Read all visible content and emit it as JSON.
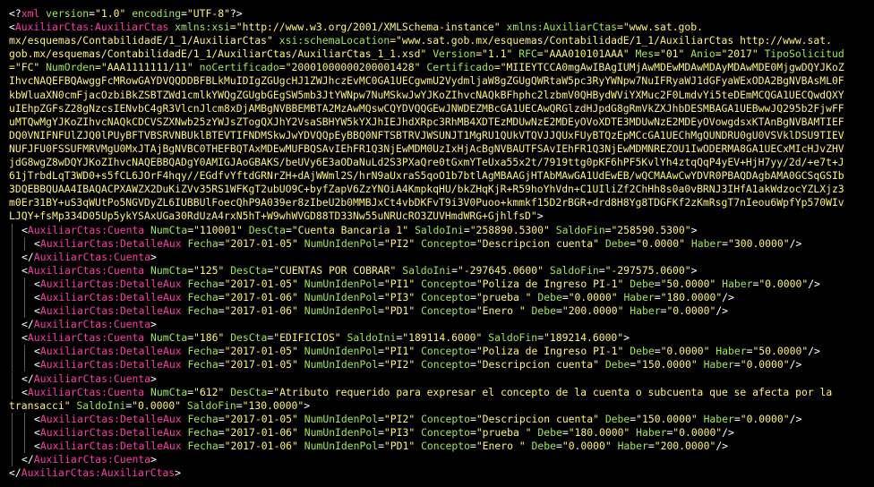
{
  "xml_declaration": {
    "text_open": "<?",
    "name": "xml",
    "version_attr": "version",
    "version_value": "\"1.0\"",
    "encoding_attr": "encoding",
    "encoding_value": "\"UTF-8\"",
    "text_close": "?>"
  },
  "root": {
    "tag": "AuxiliarCtas:AuxiliarCtas",
    "lines": [
      [
        "xmlns:xsi",
        "=\"http://www.w3.org/2001/XMLSchema-instance\"",
        "xmlns:AuxiliarCtas",
        "=\"www.sat.gob."
      ],
      [
        "",
        "mx/esquemas/ContabilidadE/1_1/AuxiliarCtas\"",
        "xsi:schemaLocation",
        "=\"www.sat.gob.mx/esquemas/ContabilidadE/1_1/AuxiliarCtas http://www.sat."
      ],
      [
        "",
        "gob.mx/esquemas/ContabilidadE/1_1/AuxiliarCtas/AuxiliarCtas_1_1.xsd\"",
        "Version",
        "=\"1.1\"",
        "RFC",
        "=\"AAA010101AAA\"",
        "Mes",
        "=\"01\"",
        "Anio",
        "=\"2017\"",
        "TipoSolicitud"
      ],
      [
        "",
        "=\"FC\"",
        "NumOrden",
        "=\"AAA1111111/11\"",
        "noCertificado",
        "=\"20001000000200001428\"",
        "Certificado",
        "=\"MIIEYTCCA0mgAwIBAgIUMjAwMDEwMDAwMDAyMDAwMDE0MjgwDQYJKoZ"
      ],
      [
        "",
        "IhvcNAQEFBQAwggFcMRowGAYDVQQDDBFBLkMuIDIgZGUgcHJ1ZWJhczEvMC0GA1UECgwmU2VydmljaW8gZGUgQWRtaW5pc3RyYWNpw7NuIFRyaWJ1dGFyaWExODA2BgNVBAsML0F"
      ],
      [
        "",
        "kbWluaXN0cmFjacOzbiBkZSBTZWd1cmlkYWQgZGUgbGEgSW5mb3JtYWNpw7NuMSkwJwYJKoZIhvcNAQkBFhphc2lzbmV0QHBydWViYXMuc2F0LmdvYi5teDEmMCQGA1UECQwdQXY"
      ],
      [
        "",
        "uIEhpZGFsZ28gNzcsIENvbC4gR3VlcnJlcm8xDjAMBgNVBBEMBTA2MzAwMQswCQYDVQQGEwJNWDEZMBcGA1UECAwQRGlzdHJpdG8gRmVkZXJhbDESMBAGA1UEBwwJQ295b2FjwFF"
      ],
      [
        "",
        "uMTQwMgYJKoZIhvcNAQkCDCVSZXNwb25zYWJsZTogQXJhY2VsaSBHYW5kYXJhIEJhdXRpc3RhMB4XDTEzMDUwNzE2MDEyOVoXDTE3MDUwNzE2MDEyOVowgdsxKTAnBgNVBAMTIEF"
      ],
      [
        "",
        "DQ0VNIFNFUlZJQ0lPUyBFTVBSRVNBUklBTEVTIFNDMSkwJwYDVQQpEyBBQ0NFTSBTRVJWSUNJT1MgRU1QUkVTQVJJQUxFUyBTQzEpMCcGA1UEChMgQUNDRU0gU0VSVklDSU9TIEV"
      ],
      [
        "",
        "NUFJFU0FSSUFMRVMgU0MxJTAjBgNVBC0THEFBQTAxMDEwMUFBQSAvIEhFR1Q3NjEwMDM0UzIxHjAcBgNVBAUTFSAvIEhFR1Q3NjEwMDMNREZOU1IwODERMA8GA1UECxMIcHJvZHV"
      ],
      [
        "",
        "jdG8wgZ8wDQYJKoZIhvcNAQEBBQADgY0AMIGJAoGBAKS/beUVy6E3aODaNuLd2S3PXaQre0tGxmYTeUxa55x2t/7919ttg0pKF6hPF5KvlYh4ztqQqP4yEV+HjH7yy/2d/+e7t+J"
      ],
      [
        "",
        "61jTrbdLqT3WD0+s5fCL6JOrF4hqy//EGdfvYftdGRNrZH+dAjWWml2S/hrN9aUxraS5qoO1b7btlAgMBAAGjHTAbMAwGA1UdEwEB/wQCMAAwCwYDVR0PBAQDAgbAMA0GCSqGSIb"
      ],
      [
        "",
        "3DQEBBQUAA4IBAQACPXAWZX2DuKiZVv35RS1WFKgT2ubUO9C+byfZapV6ZzYNOiA4KmpkqHU/bkZHqKjR+R59hoYhVdn+C1UIliZf2ChHh8s0a0vBRNJ3IHfA1akWdzocYZLXjz3"
      ],
      [
        "",
        "m0Er31BY+uS3qWUtPo5NGVDyZL6IUBBUlFoecQhP9A039er8zIbeU2b0MMBJxCt4vbDKFvT9i3V0Puoo+kmmkf15D2rBGR+drd8H8Yg8TDGFKf2zKmRsgT7nIeou6WpfYp570WIv"
      ],
      [
        "",
        "LJQY+fsMp334D05Up5ykYSAxUGa30RdUzA4rxN5hT+W9whWVGD88TD33Nw55uNRUcRO3ZUVHmdWRG+GjhlfsD\""
      ]
    ]
  },
  "cuentas": [
    {
      "tag": "AuxiliarCtas:Cuenta",
      "attrs": [
        [
          "NumCta",
          "\"110001\""
        ],
        [
          "DesCta",
          "\"Cuenta Bancaria 1\""
        ],
        [
          "SaldoIni",
          "\"258890.5300\""
        ],
        [
          "SaldoFin",
          "\"258590.5300\""
        ]
      ],
      "detalles": [
        [
          [
            "Fecha",
            "\"2017-01-05\""
          ],
          [
            "NumUnIdenPol",
            "\"PI2\""
          ],
          [
            "Concepto",
            "\"Descripcion cuenta\""
          ],
          [
            "Debe",
            "\"0.0000\""
          ],
          [
            "Haber",
            "\"300.0000\""
          ]
        ]
      ]
    },
    {
      "tag": "AuxiliarCtas:Cuenta",
      "attrs": [
        [
          "NumCta",
          "\"125\""
        ],
        [
          "DesCta",
          "\"CUENTAS POR COBRAR\""
        ],
        [
          "SaldoIni",
          "\"-297645.0600\""
        ],
        [
          "SaldoFin",
          "\"-297575.0600\""
        ]
      ],
      "detalles": [
        [
          [
            "Fecha",
            "\"2017-01-05\""
          ],
          [
            "NumUnIdenPol",
            "\"PI1\""
          ],
          [
            "Concepto",
            "\"Poliza de Ingreso PI-1\""
          ],
          [
            "Debe",
            "\"50.0000\""
          ],
          [
            "Haber",
            "\"0.0000\""
          ]
        ],
        [
          [
            "Fecha",
            "\"2017-01-06\""
          ],
          [
            "NumUnIdenPol",
            "\"PI3\""
          ],
          [
            "Concepto",
            "\"prueba \""
          ],
          [
            "Debe",
            "\"0.0000\""
          ],
          [
            "Haber",
            "\"180.0000\""
          ]
        ],
        [
          [
            "Fecha",
            "\"2017-01-06\""
          ],
          [
            "NumUnIdenPol",
            "\"PD1\""
          ],
          [
            "Concepto",
            "\"Enero \""
          ],
          [
            "Debe",
            "\"200.0000\""
          ],
          [
            "Haber",
            "\"0.0000\""
          ]
        ]
      ]
    },
    {
      "tag": "AuxiliarCtas:Cuenta",
      "attrs": [
        [
          "NumCta",
          "\"186\""
        ],
        [
          "DesCta",
          "\"EDIFICIOS\""
        ],
        [
          "SaldoIni",
          "\"189114.6000\""
        ],
        [
          "SaldoFin",
          "\"189214.6000\""
        ]
      ],
      "detalles": [
        [
          [
            "Fecha",
            "\"2017-01-05\""
          ],
          [
            "NumUnIdenPol",
            "\"PI1\""
          ],
          [
            "Concepto",
            "\"Poliza de Ingreso PI-1\""
          ],
          [
            "Debe",
            "\"0.0000\""
          ],
          [
            "Haber",
            "\"50.0000\""
          ]
        ],
        [
          [
            "Fecha",
            "\"2017-01-05\""
          ],
          [
            "NumUnIdenPol",
            "\"PI2\""
          ],
          [
            "Concepto",
            "\"Descripcion cuenta\""
          ],
          [
            "Debe",
            "\"150.0000\""
          ],
          [
            "Haber",
            "\"0.0000\""
          ]
        ]
      ]
    },
    {
      "tag": "AuxiliarCtas:Cuenta",
      "attrs": [
        [
          "NumCta",
          "\"612\""
        ],
        [
          "DesCta",
          "\"Atributo requerido para expresar el concepto de la cuenta o subcuenta que se afecta por la"
        ]
      ],
      "attrs_cont": [
        [
          "",
          "transacci\""
        ],
        [
          "SaldoIni",
          "\"0.0000\""
        ],
        [
          "SaldoFin",
          "\"130.0000\""
        ]
      ],
      "detalles": [
        [
          [
            "Fecha",
            "\"2017-01-05\""
          ],
          [
            "NumUnIdenPol",
            "\"PI2\""
          ],
          [
            "Concepto",
            "\"Descripcion cuenta\""
          ],
          [
            "Debe",
            "\"150.0000\""
          ],
          [
            "Haber",
            "\"0.0000\""
          ]
        ],
        [
          [
            "Fecha",
            "\"2017-01-06\""
          ],
          [
            "NumUnIdenPol",
            "\"PI3\""
          ],
          [
            "Concepto",
            "\"prueba \""
          ],
          [
            "Debe",
            "\"180.0000\""
          ],
          [
            "Haber",
            "\"0.0000\""
          ]
        ],
        [
          [
            "Fecha",
            "\"2017-01-06\""
          ],
          [
            "NumUnIdenPol",
            "\"PD1\""
          ],
          [
            "Concepto",
            "\"Enero \""
          ],
          [
            "Debe",
            "\"0.0000\""
          ],
          [
            "Haber",
            "\"200.0000\""
          ]
        ]
      ]
    }
  ],
  "detail_tag": "AuxiliarCtas:DetalleAux",
  "colors": {
    "background": "#000000",
    "tag": "#ff3aa6",
    "attribute": "#9fe84a",
    "value": "#fff46a",
    "punctuation": "#ffffff"
  }
}
